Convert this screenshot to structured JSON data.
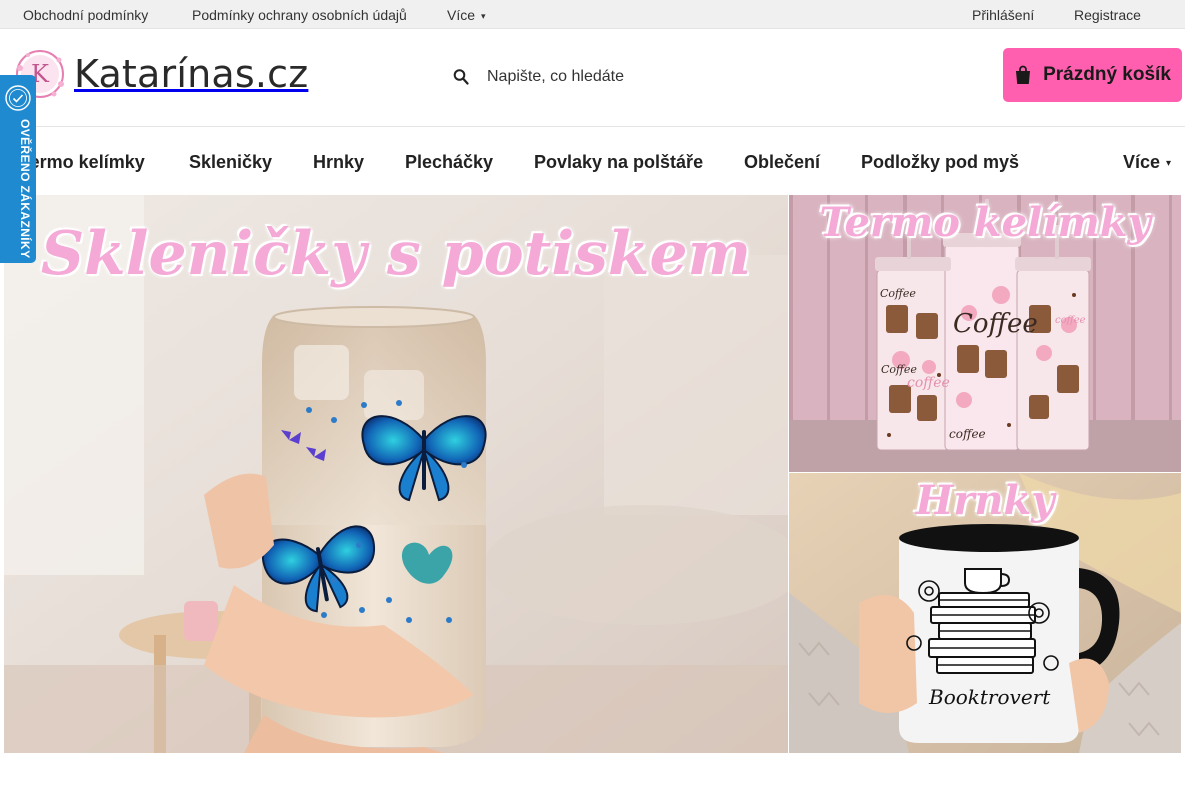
{
  "topbar": {
    "links": [
      "Obchodní podmínky",
      "Podmínky ochrany osobních údajů"
    ],
    "more_label": "Více",
    "login_label": "Přihlášení",
    "register_label": "Registrace"
  },
  "header": {
    "logo_text": "Katarínas.cz",
    "logo_letter": "K",
    "search_placeholder": "Napište, co hledáte",
    "cart_label": "Prázdný košík"
  },
  "nav": {
    "items": [
      "Termo kelímky",
      "Skleničky",
      "Hrnky",
      "Plecháčky",
      "Povlaky na polštáře",
      "Oblečení",
      "Podložky pod myš"
    ],
    "more_label": "Více"
  },
  "verified_badge": {
    "label": "OVĚŘENO ZÁKAZNÍKY"
  },
  "banners": {
    "main_title": "Skleničky s potiskem",
    "top_title": "Termo kelímky",
    "top_cup_words": [
      "Coffee",
      "Coffee",
      "coffee",
      "Coffee",
      "coffee",
      "coffee"
    ],
    "bottom_title": "Hrnky",
    "bottom_mug_text": "Booktrovert"
  },
  "colors": {
    "accent": "#ff5fae",
    "topbar_bg": "#f0f0f0",
    "badge_blue": "#1f8ad0",
    "title_pink": "#f4a9d6"
  }
}
